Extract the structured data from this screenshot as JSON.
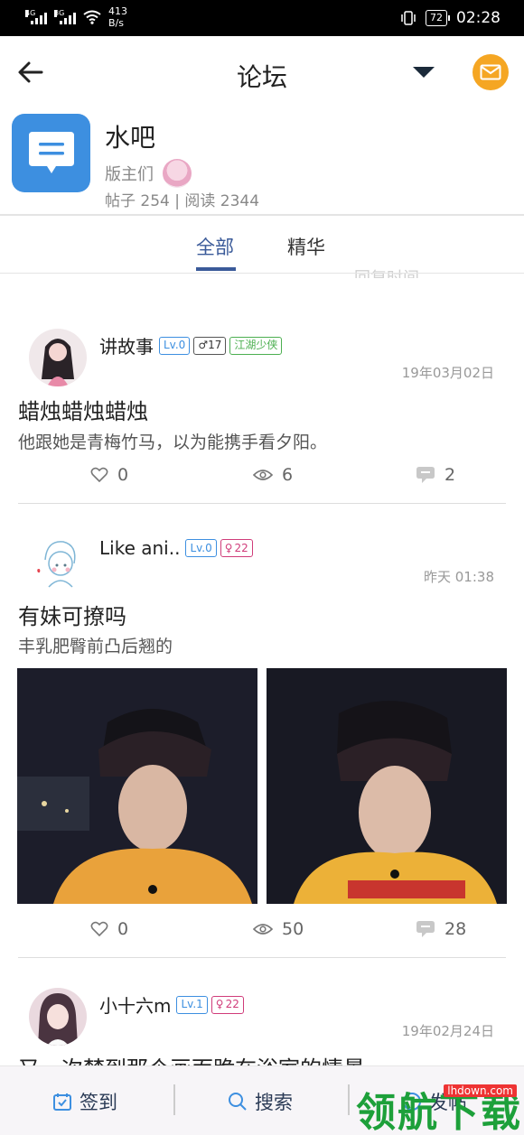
{
  "status_bar": {
    "signal1_label": "4G",
    "signal2_label": "3G",
    "speed_value": "413",
    "speed_unit": "B/s",
    "battery": "72",
    "time": "02:28"
  },
  "header": {
    "title": "论坛",
    "back_icon": "arrow-left-icon",
    "dropdown_icon": "caret-down-icon",
    "mail_icon": "envelope-icon",
    "accent_color": "#f5a623"
  },
  "forum": {
    "name": "水吧",
    "moderators_label": "版主们",
    "stats": "帖子 254 | 阅读 2344",
    "icon": "chat-bubble-icon",
    "icon_color": "#3d8fe0"
  },
  "tabs": [
    {
      "label": "全部",
      "active": true
    },
    {
      "label": "精华",
      "active": false
    }
  ],
  "sort_label": "回复时间",
  "posts": [
    {
      "author": "讲故事",
      "level": "Lv.0",
      "gender_badge": "♂17",
      "title_badge": "江湖少侠",
      "date": "19年03月02日",
      "title": "蜡烛蜡烛蜡烛",
      "body": "他跟她是青梅竹马，以为能携手看夕阳。",
      "likes": "0",
      "views": "6",
      "comments": "2"
    },
    {
      "author": "Like ani..",
      "level": "Lv.0",
      "gender_badge": "22",
      "date": "昨天 01:38",
      "title": "有妹可撩吗",
      "body": "丰乳肥臀前凸后翘的",
      "likes": "0",
      "views": "50",
      "comments": "28"
    },
    {
      "author": "小十六m",
      "level": "Lv.1",
      "gender_badge": "22",
      "date": "19年02月24日",
      "title": "又一次梦到那个画面跪在浴室的情景"
    }
  ],
  "bottom_bar": {
    "checkin": "签到",
    "search": "搜索",
    "post": "发帖"
  },
  "watermark": {
    "text": "领航下载",
    "url": "lhdown.com"
  }
}
